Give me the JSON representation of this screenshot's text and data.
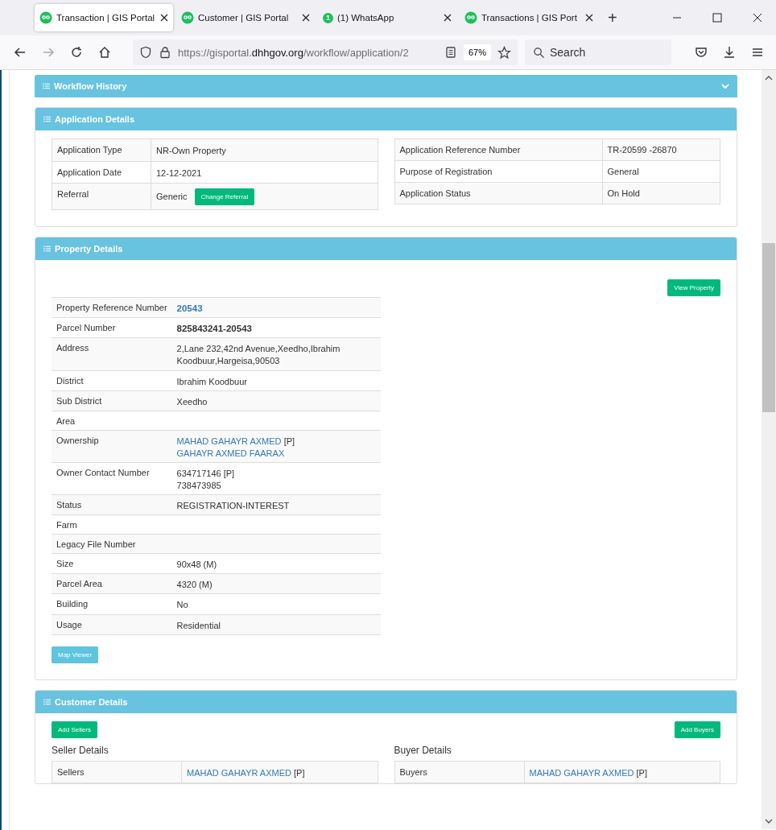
{
  "browser": {
    "tabs": [
      {
        "title": "Transaction | GIS Portal",
        "selected": true
      },
      {
        "title": "Customer | GIS Portal",
        "selected": false
      },
      {
        "title": "(1) WhatsApp",
        "badge": "1",
        "selected": false
      },
      {
        "title": "Transactions | GIS Port",
        "selected": false
      }
    ],
    "new_tab": "+",
    "url": {
      "scheme": "https://gisportal.",
      "domain": "dhhgov.org",
      "path": "/workflow/application/2"
    },
    "zoom": "67%",
    "search": {
      "placeholder": "Search"
    }
  },
  "workflow_history": {
    "title": "Workflow History",
    "expanded": false
  },
  "application_details": {
    "title": "Application Details",
    "left": [
      {
        "label": "Application Type",
        "value": "NR-Own Property"
      },
      {
        "label": "Application Date",
        "value": "12-12-2021"
      },
      {
        "label": "Referral",
        "value": "Generic",
        "button": "Change Referral"
      }
    ],
    "right": [
      {
        "label": "Application Reference Number",
        "value": "TR-20599 -26870"
      },
      {
        "label": "Purpose of Registration",
        "value": "General"
      },
      {
        "label": "Application Status",
        "value": "On Hold"
      }
    ]
  },
  "property_details": {
    "title": "Property Details",
    "view_button": "View Property",
    "map_button": "Map Viewer",
    "rows": [
      {
        "label": "Property Reference Number",
        "lines": [
          {
            "text": "20543",
            "kind": "reference"
          }
        ]
      },
      {
        "label": "Parcel Number",
        "lines": [
          {
            "text": "825843241-20543",
            "kind": "emphasis"
          }
        ]
      },
      {
        "label": "Address",
        "lines": [
          {
            "text": "2,Lane 232,42nd Avenue,Xeedho,Ibrahim Koodbuur,Hargeisa,90503",
            "kind": "text"
          }
        ]
      },
      {
        "label": "District",
        "lines": [
          {
            "text": "Ibrahim Koodbuur",
            "kind": "text"
          }
        ]
      },
      {
        "label": "Sub District",
        "lines": [
          {
            "text": "Xeedho",
            "kind": "text"
          }
        ]
      },
      {
        "label": "Area",
        "lines": []
      },
      {
        "label": "Ownership",
        "lines": [
          {
            "text": "MAHAD GAHAYR AXMED",
            "kind": "link",
            "note": "[P]"
          },
          {
            "text": "GAHAYR AXMED FAARAX",
            "kind": "link"
          }
        ]
      },
      {
        "label": "Owner Contact Number",
        "lines": [
          {
            "text": "634717146",
            "kind": "text",
            "note": "[P]"
          },
          {
            "text": "738473985",
            "kind": "text"
          }
        ]
      },
      {
        "label": "Status",
        "lines": [
          {
            "text": "REGISTRATION-INTEREST",
            "kind": "text"
          }
        ]
      },
      {
        "label": "Farm",
        "lines": []
      },
      {
        "label": "Legacy File Number",
        "lines": []
      },
      {
        "label": "Size",
        "lines": [
          {
            "text": "90x48 (M)",
            "kind": "text"
          }
        ]
      },
      {
        "label": "Parcel Area",
        "lines": [
          {
            "text": "4320 (M)",
            "kind": "text"
          }
        ]
      },
      {
        "label": "Building",
        "lines": [
          {
            "text": "No",
            "kind": "text"
          }
        ]
      },
      {
        "label": "Usage",
        "lines": [
          {
            "text": "Residential",
            "kind": "text"
          }
        ]
      }
    ]
  },
  "customer_details": {
    "title": "Customer Details",
    "add_sellers": "Add Sellers",
    "add_buyers": "Add Buyers",
    "seller": {
      "heading": "Seller Details",
      "label": "Sellers",
      "name": "MAHAD GAHAYR AXMED",
      "note": "[P]"
    },
    "buyer": {
      "heading": "Buyer Details",
      "label": "Buyers",
      "name": "MAHAD GAHAYR AXMED",
      "note": "[P]"
    }
  }
}
